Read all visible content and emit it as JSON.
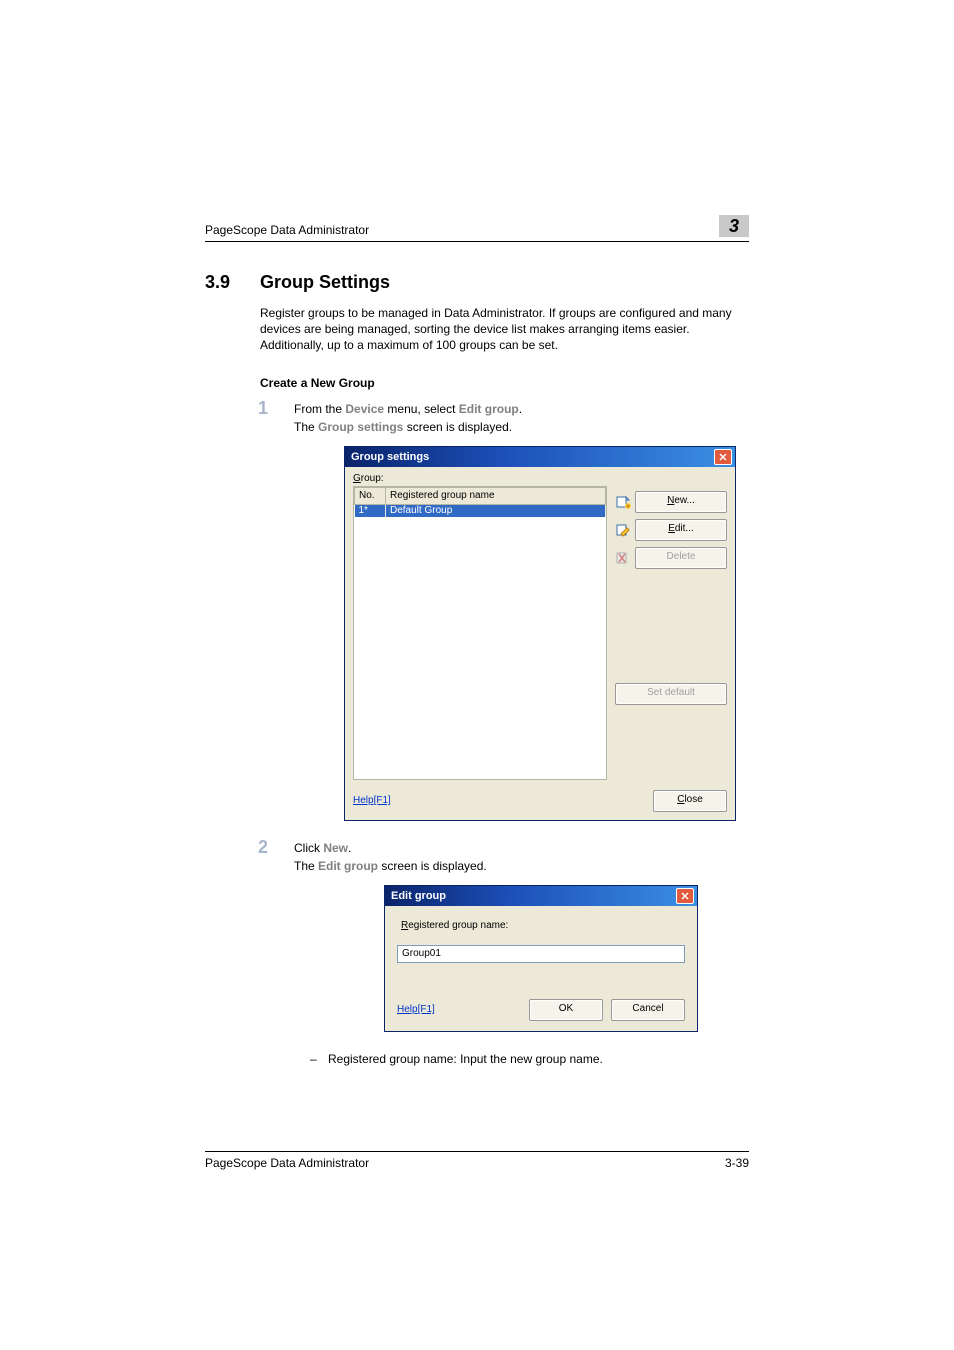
{
  "header": {
    "product": "PageScope Data Administrator",
    "chapter": "3"
  },
  "section": {
    "number": "3.9",
    "title": "Group Settings"
  },
  "intro": "Register groups to be managed in Data Administrator. If groups are configured and many devices are being managed, sorting the device list makes arranging items easier. Additionally, up to a maximum of 100 groups can be set.",
  "subhead": "Create a New Group",
  "steps": [
    {
      "num": "1",
      "line1_pre": "From the ",
      "line1_em1": "Device",
      "line1_mid": " menu, select ",
      "line1_em2": "Edit group",
      "line1_post": ".",
      "line2_pre": "The ",
      "line2_em": "Group settings",
      "line2_post": " screen is displayed."
    },
    {
      "num": "2",
      "line1_pre": "Click ",
      "line1_em1": "New",
      "line1_post": ".",
      "line2_pre": "The ",
      "line2_em": "Edit group",
      "line2_post": " screen is displayed."
    }
  ],
  "dlg1": {
    "title": "Group settings",
    "group_label": "Group:",
    "col_no": "No.",
    "col_name": "Registered group name",
    "row_no": "1*",
    "row_name": "Default Group",
    "btn_new": "New...",
    "btn_edit": "Edit...",
    "btn_delete": "Delete",
    "btn_setdefault": "Set default",
    "btn_close": "Close",
    "help": "Help[F1]"
  },
  "dlg2": {
    "title": "Edit group",
    "label": "Registered group name:",
    "value": "Group01",
    "ok": "OK",
    "cancel": "Cancel",
    "help": "Help[F1]"
  },
  "bullet": "Registered group name: Input the new group name.",
  "footer": {
    "product": "PageScope Data Administrator",
    "page": "3-39"
  }
}
